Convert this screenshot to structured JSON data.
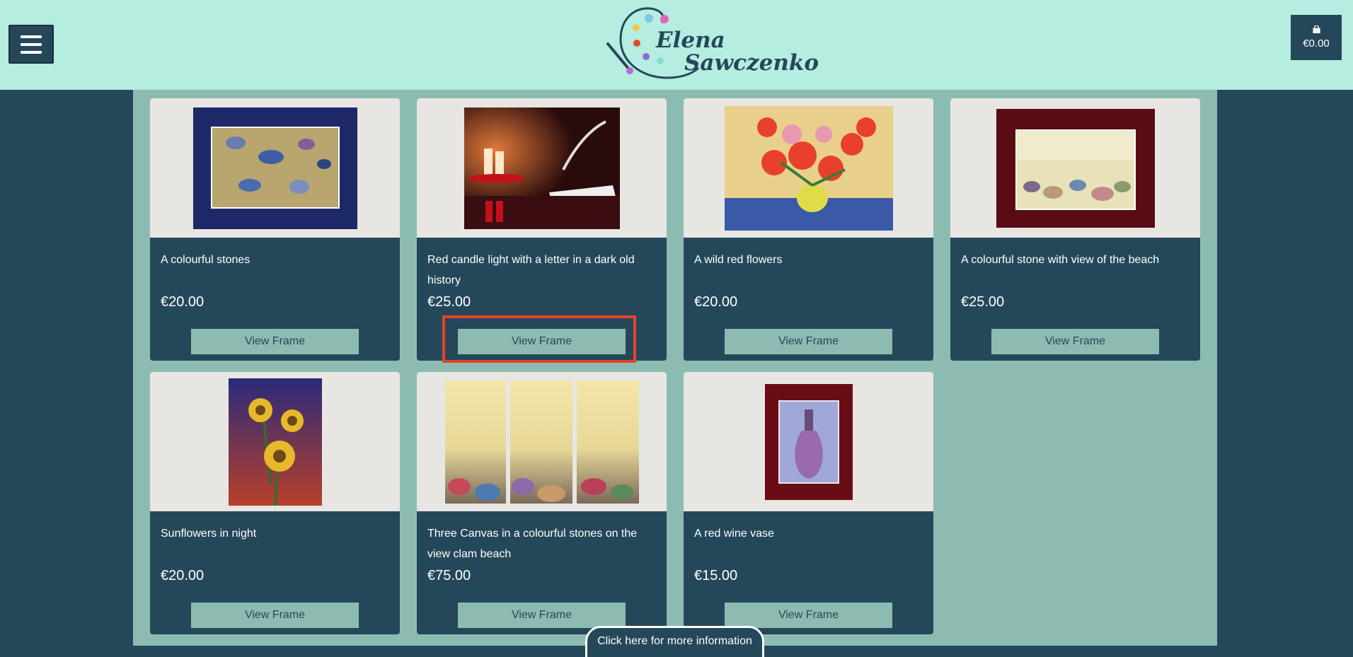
{
  "header": {
    "logo_line1": "Elena",
    "logo_line2": "Sawczenko",
    "cart_total": "€0.00"
  },
  "products": [
    {
      "title": "A colourful stones",
      "price": "€20.00",
      "button": "View Frame"
    },
    {
      "title": "Red candle light with a letter in a dark old history",
      "price": "€25.00",
      "button": "View Frame"
    },
    {
      "title": "A wild red flowers",
      "price": "€20.00",
      "button": "View Frame"
    },
    {
      "title": "A colourful stone with view of the beach",
      "price": "€25.00",
      "button": "View Frame"
    },
    {
      "title": "Sunflowers in night",
      "price": "€20.00",
      "button": "View Frame"
    },
    {
      "title": "Three Canvas in a colourful stones on the view clam beach",
      "price": "€75.00",
      "button": "View Frame"
    },
    {
      "title": "A red wine vase",
      "price": "€15.00",
      "button": "View Frame"
    }
  ],
  "footer": {
    "info_button": "Click here for more information"
  },
  "colors": {
    "header_bg": "#b5ede0",
    "page_bg": "#25475a",
    "panel_bg": "#8cbcb1",
    "card_bg": "#25475a",
    "highlight": "#e8412a"
  },
  "icons": [
    "hamburger-menu-icon",
    "shopping-bag-icon",
    "palette-brush-logo"
  ]
}
